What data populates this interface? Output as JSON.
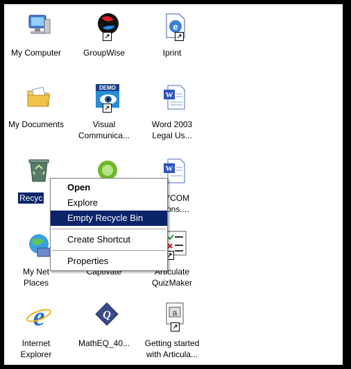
{
  "desktop": {
    "icons": [
      {
        "label": "My Computer",
        "icon": "my-computer-icon"
      },
      {
        "label": "GroupWise",
        "icon": "groupwise-icon"
      },
      {
        "label": "Iprint",
        "icon": "iprint-icon"
      },
      {
        "label": "My Documents",
        "icon": "my-documents-icon"
      },
      {
        "label": "Visual\nCommunica...",
        "icon": "demo-icon"
      },
      {
        "label": "Word 2003\nLegal Us...",
        "icon": "word-document-icon"
      },
      {
        "label": "Recyc",
        "icon": "recycle-bin-icon"
      },
      {
        "label": "POLYCOM\ntructions....",
        "icon": "word-document-icon"
      },
      {
        "label": "My Net\nPlaces",
        "icon": "network-places-icon"
      },
      {
        "label": "Captivate",
        "icon": "captivate-icon"
      },
      {
        "label": "Articulate\nQuizMaker",
        "icon": "quizmaker-icon"
      },
      {
        "label": "Internet\nExplorer",
        "icon": "internet-explorer-icon"
      },
      {
        "label": "MathEQ_40...",
        "icon": "matheq-icon"
      },
      {
        "label": "Getting started\nwith Articula...",
        "icon": "presentation-icon"
      }
    ]
  },
  "context_menu": {
    "open": "Open",
    "explore": "Explore",
    "empty_recycle_bin": "Empty Recycle Bin",
    "create_shortcut": "Create Shortcut",
    "properties": "Properties"
  },
  "colors": {
    "selection": "#0a246a",
    "frame": "#000000"
  }
}
